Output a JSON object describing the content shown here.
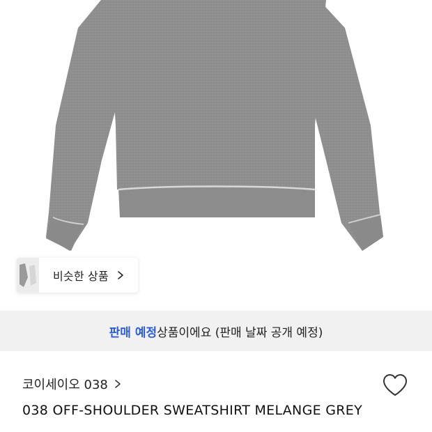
{
  "similar": {
    "label": "비슷한 상품"
  },
  "notice": {
    "highlight": "판매 예정",
    "rest": "상품이에요 (판매 날짜 공개 예정)"
  },
  "brand": {
    "name": "코이세이오 038"
  },
  "product": {
    "title": "038 OFF-SHOULDER SWEATSHIRT MELANGE GREY"
  },
  "colors": {
    "sweatshirt": "#8e8e8e",
    "accent": "#2b5cd9",
    "notice_bg": "#f1f1f2"
  },
  "icons": {
    "chip_chevron": "chevron-right-icon",
    "brand_chevron": "chevron-right-icon",
    "like": "heart-outline-icon"
  }
}
